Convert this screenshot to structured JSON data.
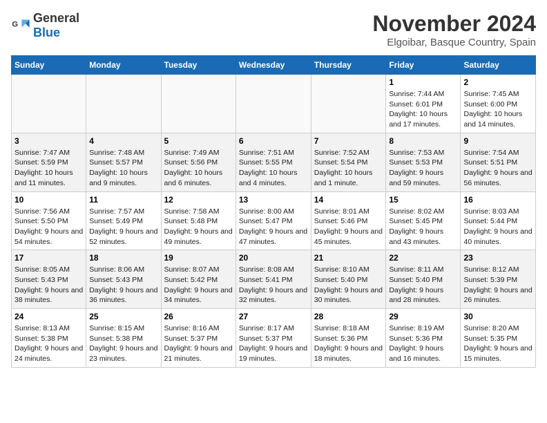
{
  "logo": {
    "general": "General",
    "blue": "Blue"
  },
  "header": {
    "title": "November 2024",
    "subtitle": "Elgoibar, Basque Country, Spain"
  },
  "weekdays": [
    "Sunday",
    "Monday",
    "Tuesday",
    "Wednesday",
    "Thursday",
    "Friday",
    "Saturday"
  ],
  "weeks": [
    [
      {
        "day": "",
        "info": ""
      },
      {
        "day": "",
        "info": ""
      },
      {
        "day": "",
        "info": ""
      },
      {
        "day": "",
        "info": ""
      },
      {
        "day": "",
        "info": ""
      },
      {
        "day": "1",
        "info": "Sunrise: 7:44 AM\nSunset: 6:01 PM\nDaylight: 10 hours and 17 minutes."
      },
      {
        "day": "2",
        "info": "Sunrise: 7:45 AM\nSunset: 6:00 PM\nDaylight: 10 hours and 14 minutes."
      }
    ],
    [
      {
        "day": "3",
        "info": "Sunrise: 7:47 AM\nSunset: 5:59 PM\nDaylight: 10 hours and 11 minutes."
      },
      {
        "day": "4",
        "info": "Sunrise: 7:48 AM\nSunset: 5:57 PM\nDaylight: 10 hours and 9 minutes."
      },
      {
        "day": "5",
        "info": "Sunrise: 7:49 AM\nSunset: 5:56 PM\nDaylight: 10 hours and 6 minutes."
      },
      {
        "day": "6",
        "info": "Sunrise: 7:51 AM\nSunset: 5:55 PM\nDaylight: 10 hours and 4 minutes."
      },
      {
        "day": "7",
        "info": "Sunrise: 7:52 AM\nSunset: 5:54 PM\nDaylight: 10 hours and 1 minute."
      },
      {
        "day": "8",
        "info": "Sunrise: 7:53 AM\nSunset: 5:53 PM\nDaylight: 9 hours and 59 minutes."
      },
      {
        "day": "9",
        "info": "Sunrise: 7:54 AM\nSunset: 5:51 PM\nDaylight: 9 hours and 56 minutes."
      }
    ],
    [
      {
        "day": "10",
        "info": "Sunrise: 7:56 AM\nSunset: 5:50 PM\nDaylight: 9 hours and 54 minutes."
      },
      {
        "day": "11",
        "info": "Sunrise: 7:57 AM\nSunset: 5:49 PM\nDaylight: 9 hours and 52 minutes."
      },
      {
        "day": "12",
        "info": "Sunrise: 7:58 AM\nSunset: 5:48 PM\nDaylight: 9 hours and 49 minutes."
      },
      {
        "day": "13",
        "info": "Sunrise: 8:00 AM\nSunset: 5:47 PM\nDaylight: 9 hours and 47 minutes."
      },
      {
        "day": "14",
        "info": "Sunrise: 8:01 AM\nSunset: 5:46 PM\nDaylight: 9 hours and 45 minutes."
      },
      {
        "day": "15",
        "info": "Sunrise: 8:02 AM\nSunset: 5:45 PM\nDaylight: 9 hours and 43 minutes."
      },
      {
        "day": "16",
        "info": "Sunrise: 8:03 AM\nSunset: 5:44 PM\nDaylight: 9 hours and 40 minutes."
      }
    ],
    [
      {
        "day": "17",
        "info": "Sunrise: 8:05 AM\nSunset: 5:43 PM\nDaylight: 9 hours and 38 minutes."
      },
      {
        "day": "18",
        "info": "Sunrise: 8:06 AM\nSunset: 5:43 PM\nDaylight: 9 hours and 36 minutes."
      },
      {
        "day": "19",
        "info": "Sunrise: 8:07 AM\nSunset: 5:42 PM\nDaylight: 9 hours and 34 minutes."
      },
      {
        "day": "20",
        "info": "Sunrise: 8:08 AM\nSunset: 5:41 PM\nDaylight: 9 hours and 32 minutes."
      },
      {
        "day": "21",
        "info": "Sunrise: 8:10 AM\nSunset: 5:40 PM\nDaylight: 9 hours and 30 minutes."
      },
      {
        "day": "22",
        "info": "Sunrise: 8:11 AM\nSunset: 5:40 PM\nDaylight: 9 hours and 28 minutes."
      },
      {
        "day": "23",
        "info": "Sunrise: 8:12 AM\nSunset: 5:39 PM\nDaylight: 9 hours and 26 minutes."
      }
    ],
    [
      {
        "day": "24",
        "info": "Sunrise: 8:13 AM\nSunset: 5:38 PM\nDaylight: 9 hours and 24 minutes."
      },
      {
        "day": "25",
        "info": "Sunrise: 8:15 AM\nSunset: 5:38 PM\nDaylight: 9 hours and 23 minutes."
      },
      {
        "day": "26",
        "info": "Sunrise: 8:16 AM\nSunset: 5:37 PM\nDaylight: 9 hours and 21 minutes."
      },
      {
        "day": "27",
        "info": "Sunrise: 8:17 AM\nSunset: 5:37 PM\nDaylight: 9 hours and 19 minutes."
      },
      {
        "day": "28",
        "info": "Sunrise: 8:18 AM\nSunset: 5:36 PM\nDaylight: 9 hours and 18 minutes."
      },
      {
        "day": "29",
        "info": "Sunrise: 8:19 AM\nSunset: 5:36 PM\nDaylight: 9 hours and 16 minutes."
      },
      {
        "day": "30",
        "info": "Sunrise: 8:20 AM\nSunset: 5:35 PM\nDaylight: 9 hours and 15 minutes."
      }
    ]
  ]
}
